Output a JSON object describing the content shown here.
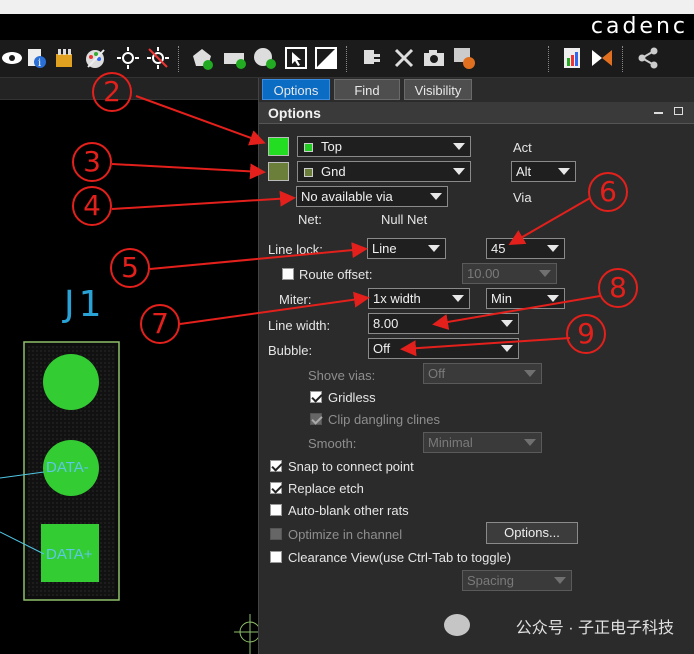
{
  "brand": "cadenc",
  "tabs": [
    {
      "label": "Options",
      "active": true
    },
    {
      "label": "Find",
      "active": false
    },
    {
      "label": "Visibility",
      "active": false
    }
  ],
  "panel": {
    "title": "Options",
    "act_label": "Act",
    "via_label": "Via",
    "layer_top": {
      "value": "Top",
      "color": "#22cc22"
    },
    "layer_gnd": {
      "value": "Gnd",
      "color": "#6b7f3a"
    },
    "act_select": "Alt",
    "via_select": "No available via",
    "net_label": "Net:",
    "net_value": "Null Net",
    "line_lock": {
      "label": "Line lock:",
      "value": "Line",
      "angle": "45"
    },
    "route_offset": {
      "label": "Route offset:",
      "value": "10.00",
      "checked": false
    },
    "miter": {
      "label": "Miter:",
      "value": "1x width",
      "mode": "Min"
    },
    "line_width": {
      "label": "Line width:",
      "value": "8.00"
    },
    "bubble": {
      "label": "Bubble:",
      "value": "Off"
    },
    "shove_vias": {
      "label": "Shove vias:",
      "value": "Off"
    },
    "gridless": {
      "label": "Gridless",
      "checked": true
    },
    "clip_dangling": {
      "label": "Clip dangling clines",
      "checked": true
    },
    "smooth": {
      "label": "Smooth:",
      "value": "Minimal"
    },
    "snap": {
      "label": "Snap to connect point",
      "checked": true
    },
    "replace_etch": {
      "label": "Replace etch",
      "checked": true
    },
    "auto_blank": {
      "label": "Auto-blank other rats",
      "checked": false
    },
    "optimize": {
      "label": "Optimize in channel",
      "checked": false
    },
    "options_button": "Options...",
    "clearance": {
      "label": "Clearance View(use Ctrl-Tab to toggle)",
      "checked": false
    },
    "spacing": "Spacing"
  },
  "canvas": {
    "ref_designator": "J1",
    "pad1_label": "DATA-",
    "pad2_label": "DATA+",
    "pad_color": "#33cc33"
  },
  "annotations": [
    "2",
    "3",
    "4",
    "5",
    "6",
    "7",
    "8",
    "9"
  ],
  "watermark": "公众号 · 子正电子科技"
}
